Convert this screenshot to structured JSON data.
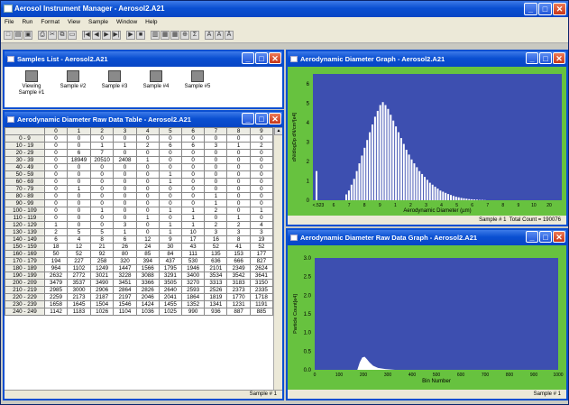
{
  "app": {
    "title": "Aerosol Instrument Manager - Aerosol2.A21"
  },
  "menu": [
    "File",
    "Run",
    "Format",
    "View",
    "Sample",
    "Window",
    "Help"
  ],
  "toolbar_icons": [
    "new-icon",
    "open-icon",
    "save-icon",
    "print-icon",
    "cut-icon",
    "copy-icon",
    "paste-icon",
    "first-icon",
    "prev-icon",
    "next-icon",
    "last-icon",
    "play-icon",
    "stop-icon",
    "graph-icon",
    "table-icon",
    "grid-icon",
    "zoom-icon",
    "stats-icon",
    "font-icon",
    "bold-icon",
    "font-size-icon"
  ],
  "samples_window": {
    "title": "Samples List - Aerosol2.A21",
    "items": [
      {
        "label1": "Viewing",
        "label2": "Sample #1"
      },
      {
        "label1": "Sample #2",
        "label2": ""
      },
      {
        "label1": "Sample #3",
        "label2": ""
      },
      {
        "label1": "Sample #4",
        "label2": ""
      },
      {
        "label1": "Sample #5",
        "label2": ""
      }
    ]
  },
  "table_window": {
    "title": "Aerodynamic Diameter Raw Data Table - Aerosol2.A21",
    "columns": [
      "",
      "0",
      "1",
      "2",
      "3",
      "4",
      "5",
      "6",
      "7",
      "8",
      "9"
    ],
    "rows": [
      [
        "0 - 9",
        "0",
        "0",
        "0",
        "0",
        "0",
        "0",
        "0",
        "0",
        "0",
        "0"
      ],
      [
        "10 - 19",
        "0",
        "0",
        "1",
        "1",
        "2",
        "6",
        "6",
        "3",
        "1",
        "2"
      ],
      [
        "20 - 29",
        "0",
        "6",
        "7",
        "0",
        "0",
        "0",
        "0",
        "0",
        "0",
        "0"
      ],
      [
        "30 - 39",
        "0",
        "18949",
        "20510",
        "2408",
        "1",
        "0",
        "0",
        "0",
        "0",
        "0"
      ],
      [
        "40 - 49",
        "0",
        "0",
        "0",
        "0",
        "0",
        "0",
        "0",
        "0",
        "0",
        "0"
      ],
      [
        "50 - 59",
        "0",
        "0",
        "0",
        "0",
        "0",
        "1",
        "0",
        "0",
        "0",
        "0"
      ],
      [
        "60 - 69",
        "0",
        "0",
        "0",
        "0",
        "0",
        "1",
        "0",
        "0",
        "0",
        "0"
      ],
      [
        "70 - 79",
        "0",
        "1",
        "0",
        "0",
        "0",
        "0",
        "0",
        "0",
        "0",
        "0"
      ],
      [
        "80 - 89",
        "0",
        "0",
        "0",
        "0",
        "0",
        "0",
        "0",
        "1",
        "0",
        "0"
      ],
      [
        "90 - 99",
        "0",
        "0",
        "0",
        "0",
        "0",
        "0",
        "0",
        "1",
        "0",
        "0"
      ],
      [
        "100 - 109",
        "0",
        "0",
        "1",
        "0",
        "0",
        "1",
        "1",
        "2",
        "0",
        "1"
      ],
      [
        "110 - 119",
        "0",
        "0",
        "0",
        "0",
        "1",
        "0",
        "1",
        "0",
        "1",
        "0"
      ],
      [
        "120 - 129",
        "1",
        "0",
        "0",
        "3",
        "0",
        "1",
        "1",
        "2",
        "2",
        "4"
      ],
      [
        "130 - 139",
        "2",
        "5",
        "5",
        "1",
        "0",
        "1",
        "10",
        "3",
        "3",
        "3"
      ],
      [
        "140 - 149",
        "6",
        "4",
        "8",
        "6",
        "12",
        "9",
        "17",
        "16",
        "8",
        "19"
      ],
      [
        "150 - 159",
        "18",
        "12",
        "21",
        "26",
        "24",
        "30",
        "43",
        "52",
        "41",
        "52"
      ],
      [
        "160 - 169",
        "50",
        "52",
        "92",
        "80",
        "85",
        "84",
        "111",
        "135",
        "153",
        "177"
      ],
      [
        "170 - 179",
        "194",
        "227",
        "258",
        "320",
        "394",
        "437",
        "530",
        "636",
        "666",
        "827"
      ],
      [
        "180 - 189",
        "964",
        "1102",
        "1249",
        "1447",
        "1566",
        "1795",
        "1946",
        "2101",
        "2349",
        "2624"
      ],
      [
        "190 - 199",
        "2632",
        "2772",
        "3021",
        "3228",
        "3088",
        "3291",
        "3400",
        "3534",
        "3542",
        "3641"
      ],
      [
        "200 - 209",
        "3479",
        "3537",
        "3490",
        "3451",
        "3366",
        "3505",
        "3270",
        "3313",
        "3183",
        "3150"
      ],
      [
        "210 - 219",
        "2985",
        "3000",
        "2906",
        "2864",
        "2826",
        "2640",
        "2593",
        "2526",
        "2373",
        "2335"
      ],
      [
        "220 - 229",
        "2259",
        "2173",
        "2187",
        "2197",
        "2046",
        "2041",
        "1864",
        "1819",
        "1770",
        "1718"
      ],
      [
        "230 - 239",
        "1658",
        "1645",
        "1504",
        "1546",
        "1424",
        "1455",
        "1352",
        "1341",
        "1231",
        "1191"
      ],
      [
        "240 - 249",
        "1142",
        "1183",
        "1026",
        "1104",
        "1036",
        "1025",
        "990",
        "936",
        "887",
        "885"
      ]
    ],
    "status": "Sample # 1"
  },
  "diameter_graph": {
    "title": "Aerodynamic Diameter Graph - Aerosol2.A21",
    "ylabel": "dN/dlogDp dN/cm³[e4]",
    "xlabel": "Aerodynamic Diameter (µm)",
    "status_sample": "Sample # 1",
    "status_count": "Total Count = 190076",
    "colors": {
      "plot_bg": "#3d4fb0",
      "frame_bg": "#67c23f",
      "bars": "#ffffff"
    }
  },
  "raw_graph": {
    "title": "Aerodynamic Diameter  Raw Data Graph - Aerosol2.A21",
    "ylabel": "Particle Count[e4]",
    "xlabel": "Bin Number",
    "status": "Sample # 1",
    "colors": {
      "plot_bg": "#3d4fb0",
      "frame_bg": "#67c23f",
      "curve": "#ffffff"
    }
  },
  "chart_data": [
    {
      "type": "bar",
      "title": "Aerodynamic Diameter Graph",
      "xlabel": "Aerodynamic Diameter (µm)",
      "ylabel": "dN/dlogDp dN/cm³[e4]",
      "x_tick_labels": [
        "<.523",
        "6",
        "7",
        "8",
        "9",
        "1",
        "2",
        "3",
        "4",
        "5",
        "6",
        "7",
        "8",
        "9",
        "10",
        "20"
      ],
      "y_ticks": [
        "0",
        "1",
        "2",
        "3",
        "4",
        "5",
        "6"
      ],
      "ylim": [
        0,
        6.5
      ],
      "first_bar": 1.5,
      "values": [
        0.3,
        0.5,
        0.8,
        1.1,
        1.5,
        1.9,
        2.3,
        2.7,
        3.1,
        3.5,
        3.9,
        4.3,
        4.6,
        4.9,
        5.05,
        4.9,
        4.7,
        4.4,
        4.1,
        3.8,
        3.5,
        3.2,
        2.9,
        2.6,
        2.35,
        2.1,
        1.9,
        1.7,
        1.5,
        1.35,
        1.2,
        1.05,
        0.9,
        0.8,
        0.7,
        0.6,
        0.5,
        0.44,
        0.38,
        0.32,
        0.27,
        0.22,
        0.18,
        0.15,
        0.12,
        0.1,
        0.08,
        0.06,
        0.05,
        0.04,
        0.03,
        0.02,
        0.02,
        0.01
      ]
    },
    {
      "type": "line",
      "title": "Aerodynamic Diameter Raw Data Graph",
      "xlabel": "Bin Number",
      "ylabel": "Particle Count[e4]",
      "x_ticks": [
        "0",
        "100",
        "200",
        "300",
        "400",
        "500",
        "600",
        "700",
        "800",
        "900",
        "1000"
      ],
      "y_ticks": [
        "0.0",
        "0.5",
        "1.0",
        "1.5",
        "2.0",
        "2.5",
        "3.0"
      ],
      "xlim": [
        0,
        1000
      ],
      "ylim": [
        0,
        3.0
      ],
      "points": [
        [
          0,
          0
        ],
        [
          175,
          0
        ],
        [
          185,
          0.2
        ],
        [
          195,
          0.33
        ],
        [
          205,
          0.35
        ],
        [
          215,
          0.28
        ],
        [
          225,
          0.2
        ],
        [
          240,
          0.11
        ],
        [
          260,
          0.05
        ],
        [
          290,
          0.02
        ],
        [
          330,
          0
        ],
        [
          1000,
          0
        ]
      ]
    }
  ]
}
